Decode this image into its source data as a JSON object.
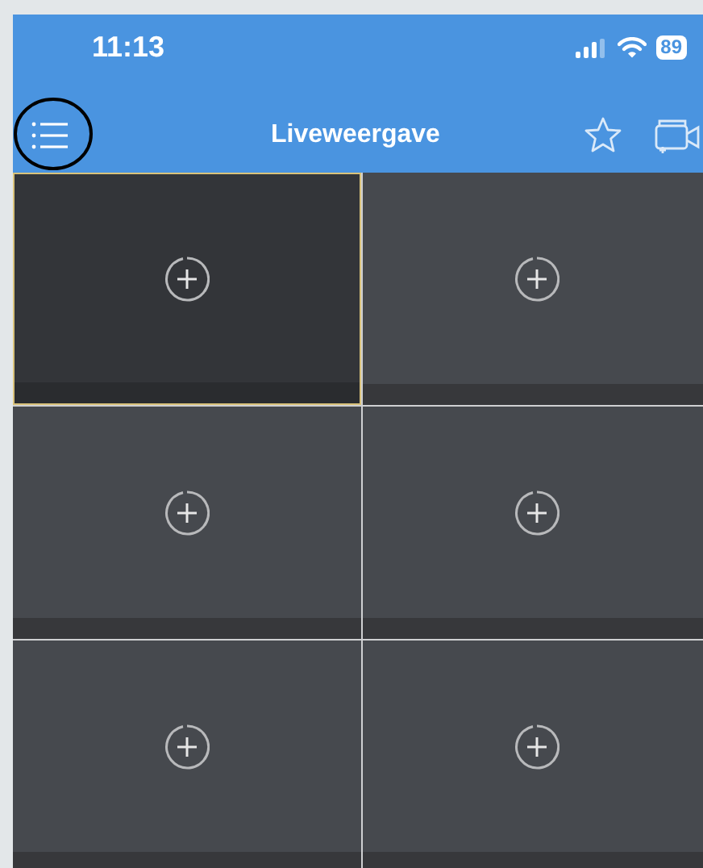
{
  "status_bar": {
    "time": "11:13",
    "battery": "89"
  },
  "nav_bar": {
    "title": "Liveweergave"
  },
  "cells": [
    {
      "selected": true
    },
    {
      "selected": false
    },
    {
      "selected": false
    },
    {
      "selected": false
    },
    {
      "selected": false
    },
    {
      "selected": false
    }
  ]
}
